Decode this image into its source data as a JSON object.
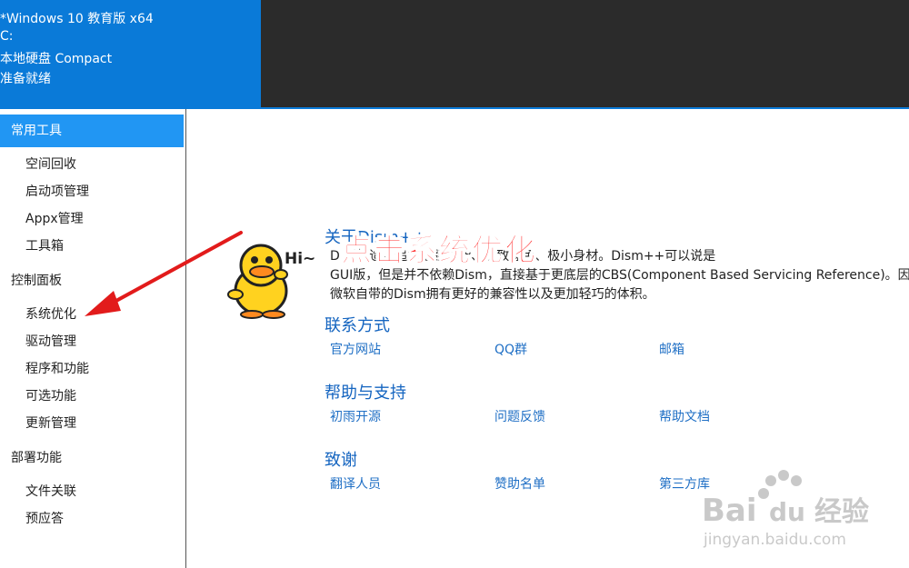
{
  "header": {
    "lines": [
      "*Windows 10 教育版 x64",
      "C:",
      "本地硬盘 Compact",
      "准备就绪"
    ]
  },
  "sidebar": {
    "groups": [
      {
        "label": "常用工具",
        "items": [
          "空间回收",
          "启动项管理",
          "Appx管理",
          "工具箱"
        ]
      },
      {
        "label": "控制面板",
        "items": [
          "系统优化",
          "驱动管理",
          "程序和功能",
          "可选功能",
          "更新管理"
        ]
      },
      {
        "label": "部署功能",
        "items": [
          "文件关联",
          "预应答"
        ]
      }
    ]
  },
  "main": {
    "about_title": "关于Dism++",
    "about_lines": [
      "D 者打造，追求最强功能、极致绿色、极小身材。Dism++可以说是",
      "GUI版，但是并不依赖Dism，直接基于更底层的CBS(Component Based Servicing Reference)。因此",
      "微软自带的Dism拥有更好的兼容性以及更加轻巧的体积。"
    ],
    "sections": [
      {
        "title": "联系方式",
        "links": [
          "官方网站",
          "QQ群",
          "邮箱"
        ]
      },
      {
        "title": "帮助与支持",
        "links": [
          "初雨开源",
          "问题反馈",
          "帮助文档"
        ]
      },
      {
        "title": "致谢",
        "links": [
          "翻译人员",
          "赞助名单",
          "第三方库"
        ]
      }
    ]
  },
  "annotation": {
    "overlay_text": "点击系统优化",
    "duck_text": "Hi~"
  },
  "watermark": {
    "brand": "Bai",
    "brand2": "du",
    "brand_cn": "经验",
    "url": "jingyan.baidu.com"
  },
  "colors": {
    "header_blue": "#0a7ad8",
    "header_dark": "#2b2b2b",
    "active_item": "#2196f3",
    "link_blue": "#1f6fc5",
    "section_blue": "#1565c0",
    "annotation_red": "#ff2d2d"
  }
}
